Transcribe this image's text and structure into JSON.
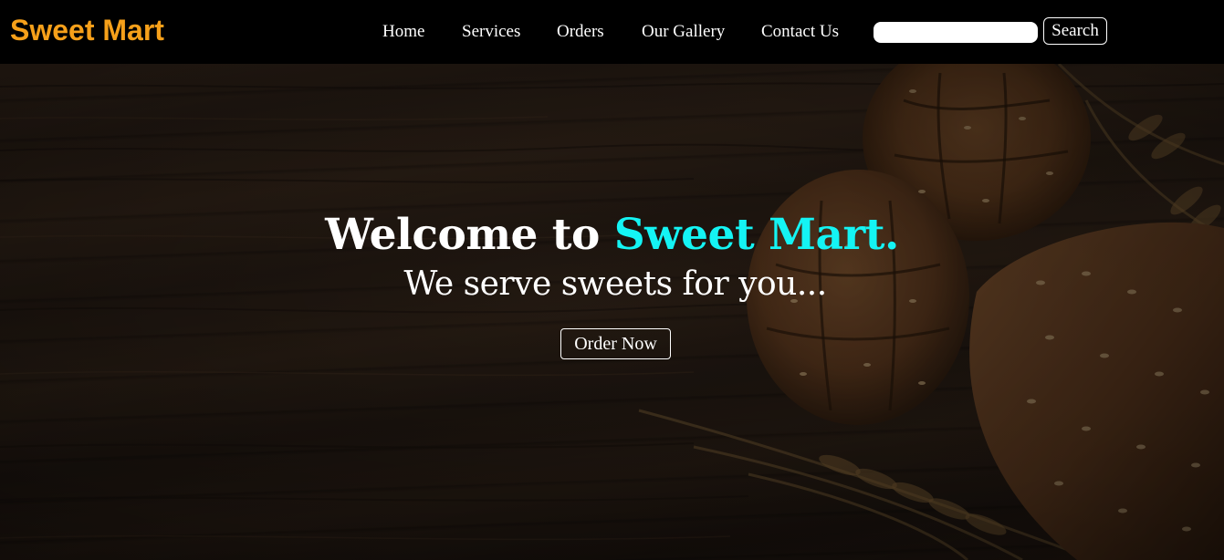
{
  "brand": {
    "name": "Sweet Mart",
    "color": "#f6a01a"
  },
  "nav": {
    "items": [
      {
        "label": "Home"
      },
      {
        "label": "Services"
      },
      {
        "label": "Orders"
      },
      {
        "label": "Our Gallery"
      },
      {
        "label": "Contact Us"
      }
    ]
  },
  "search": {
    "value": "",
    "placeholder": "",
    "button_label": "Search"
  },
  "hero": {
    "title_prefix": "Welcome to ",
    "title_accent": "Sweet Mart.",
    "accent_color": "#14f4f4",
    "subtitle": "We serve sweets for you...",
    "cta_label": "Order Now",
    "background_image": "bread-and-wheat-on-wooden-table"
  }
}
